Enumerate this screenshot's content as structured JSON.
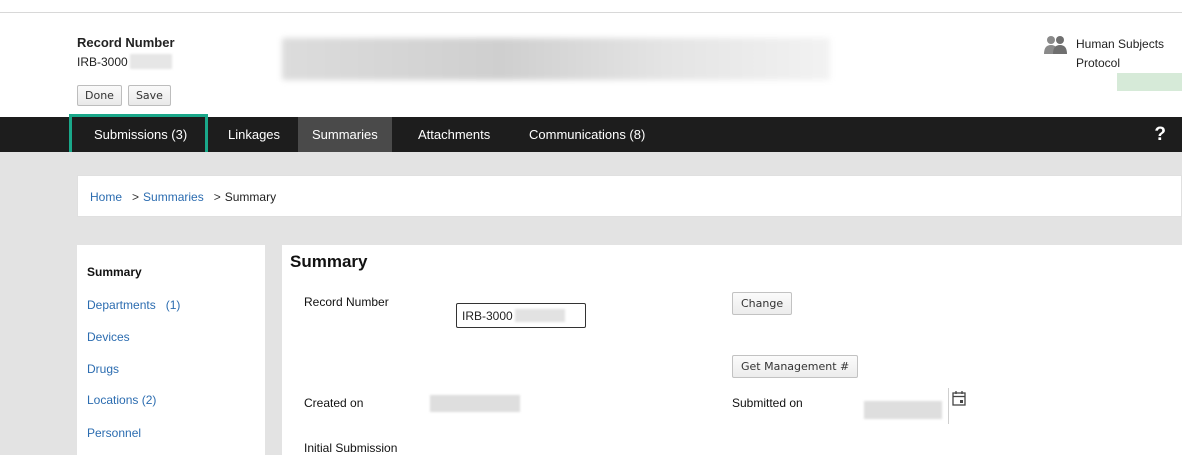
{
  "header": {
    "record_title": "Record Number",
    "record_id": "IRB-3000",
    "done_label": "Done",
    "save_label": "Save",
    "type_label": "Human Subjects",
    "type_sub": "Protocol"
  },
  "nav": {
    "tabs": [
      {
        "label": "Submissions (3)"
      },
      {
        "label": "Linkages"
      },
      {
        "label": "Summaries"
      },
      {
        "label": "Attachments"
      },
      {
        "label": "Communications (8)"
      }
    ],
    "help": "?"
  },
  "breadcrumb": {
    "home": "Home",
    "sep": ">",
    "summaries": "Summaries",
    "current": "Summary"
  },
  "sidebar": {
    "items": [
      {
        "label": "Summary"
      },
      {
        "label": "Departments   (1)"
      },
      {
        "label": "Devices"
      },
      {
        "label": "Drugs"
      },
      {
        "label": "Locations (2)"
      },
      {
        "label": "Personnel"
      }
    ]
  },
  "main": {
    "title": "Summary",
    "record_number_label": "Record Number",
    "record_number_value": "IRB-3000",
    "change_label": "Change",
    "get_mgmt_label": "Get Management #",
    "created_on_label": "Created on",
    "submitted_on_label": "Submitted on",
    "initial_submission_label": "Initial Submission"
  },
  "icons": {
    "human_subjects": "people-icon",
    "calendar": "calendar-icon"
  },
  "colors": {
    "nav_bg": "#1d1d1d",
    "active_tab": "#4a4a4a",
    "highlight": "#1aa88a",
    "link": "#2b6cb0"
  }
}
